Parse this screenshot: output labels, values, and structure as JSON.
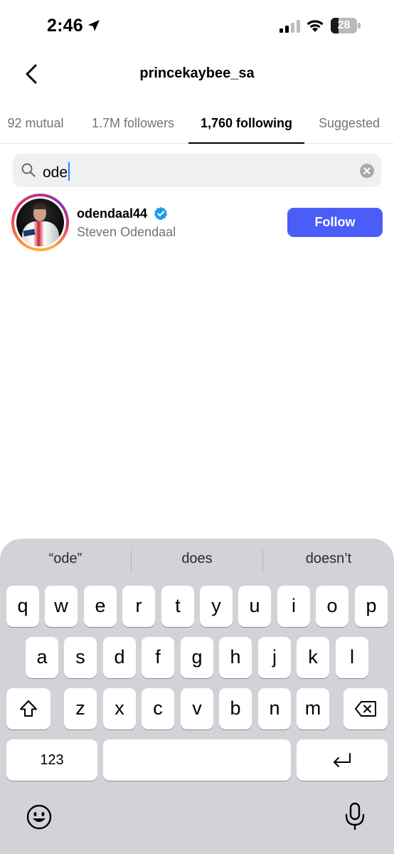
{
  "status_bar": {
    "time": "2:46",
    "battery": "28",
    "icons": [
      "location-arrow-icon",
      "cellular-signal-icon",
      "wifi-icon",
      "battery-icon"
    ]
  },
  "header": {
    "title": "princekaybee_sa",
    "back_icon": "chevron-left-icon"
  },
  "tabs": [
    {
      "label": "92 mutual",
      "active": false
    },
    {
      "label": "1.7M followers",
      "active": false
    },
    {
      "label": "1,760 following",
      "active": true
    },
    {
      "label": "Suggested",
      "active": false
    }
  ],
  "search": {
    "value": "ode",
    "icon": "search-icon",
    "clear_icon": "clear-icon"
  },
  "results": [
    {
      "username": "odendaal44",
      "full_name": "Steven Odendaal",
      "verified": true,
      "button_label": "Follow"
    }
  ],
  "keyboard": {
    "suggestions": [
      "“ode”",
      "does",
      "doesn’t"
    ],
    "row1": [
      "q",
      "w",
      "e",
      "r",
      "t",
      "y",
      "u",
      "i",
      "o",
      "p"
    ],
    "row2": [
      "a",
      "s",
      "d",
      "f",
      "g",
      "h",
      "j",
      "k",
      "l"
    ],
    "row3": [
      "z",
      "x",
      "c",
      "v",
      "b",
      "n",
      "m"
    ],
    "numbers_key": "123",
    "icons": [
      "shift-icon",
      "backspace-icon",
      "return-icon",
      "emoji-icon",
      "microphone-icon"
    ]
  },
  "colors": {
    "follow_button": "#4a5df9",
    "verified_badge": "#1d9bf0",
    "keyboard_bg": "#d1d3d9"
  }
}
